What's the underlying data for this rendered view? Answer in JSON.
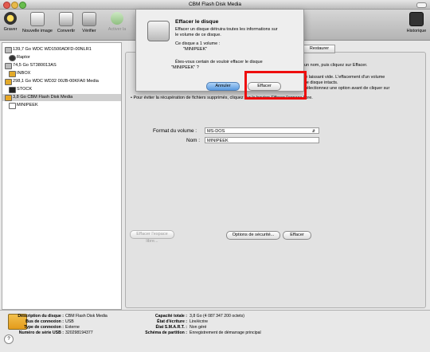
{
  "window": {
    "title": "CBM Flash Disk Media"
  },
  "toolbar": {
    "items": [
      {
        "label": "Graver",
        "icon": "burn-icon"
      },
      {
        "label": "Nouvelle image",
        "icon": "new-image-icon"
      },
      {
        "label": "Convertir",
        "icon": "convert-icon"
      },
      {
        "label": "Vérifier",
        "icon": "verify-icon"
      },
      {
        "label": "Activer la",
        "icon": "enable-icon"
      }
    ],
    "right_label": "Historique"
  },
  "sidebar": {
    "items": [
      {
        "label": "139,7 Go WDC WD1500ADFD-00NLR1",
        "indent": 0
      },
      {
        "label": "Raptor",
        "indent": 1
      },
      {
        "label": "74,5 Go ST380013AS",
        "indent": 0
      },
      {
        "label": "INBOX",
        "indent": 1
      },
      {
        "label": "298,1 Go WDC WD32 00JB-00KFA0 Media",
        "indent": 0
      },
      {
        "label": "STOCK",
        "indent": 1
      },
      {
        "label": "3,8 Go CBM Flash Disk Media",
        "indent": 0,
        "selected": true
      },
      {
        "label": "MINIPEEK",
        "indent": 1
      }
    ]
  },
  "main": {
    "restore_tab": "Restaurer",
    "body_line_1": "un nom, puis cliquez sur Effacer.",
    "body_line_2": "le laissant vide. L'effacement d'un volume",
    "body_line_3": "ce disque intacts.",
    "body_line_4": "sélectionnez une option avant de cliquer sur",
    "body_line_5": "• Pour éviter la récupération de fichiers supprimés, cliquez sur le bouton Effacer l'espace libre.",
    "format_label": "Format du volume :",
    "format_value": "MS-DOS",
    "name_label": "Nom :",
    "name_value": "MINIPEEK",
    "erase_free_space": "Effacer l'espace libre...",
    "security_options": "Options de sécurité...",
    "erase_button": "Effacer"
  },
  "sheet": {
    "title": "Effacer le disque",
    "subtitle_1": "Effacer un disque détruira toutes les informations sur",
    "subtitle_2": "le volume de ce disque.",
    "volume_info_1": "Ce disque a 1 volume :",
    "volume_info_2": "\"MINIPEEK\"",
    "confirm_1": "Êtes-vous certain de vouloir effacer le disque",
    "confirm_2": "\"MINIPEEK\" ?",
    "cancel": "Annuler",
    "erase": "Effacer"
  },
  "details": {
    "left": [
      {
        "key": "Description du disque :",
        "value": "CBM Flash Disk Media"
      },
      {
        "key": "Bus de connexion :",
        "value": "USB"
      },
      {
        "key": "Type de connexion :",
        "value": "Externe"
      },
      {
        "key": "Numéro de série USB :",
        "value": "320298194377"
      }
    ],
    "right": [
      {
        "key": "Capacité totale :",
        "value": "3,8 Go (4 087 347 200 octets)"
      },
      {
        "key": "État d'écriture :",
        "value": "Lire/écrire"
      },
      {
        "key": "État S.M.A.R.T. :",
        "value": "Non géré"
      },
      {
        "key": "Schéma de partition :",
        "value": "Enregistrement de démarrage principal"
      }
    ],
    "help": "?"
  },
  "colors": {
    "highlight": "#ee0d0d",
    "selection": "#cfcfcf",
    "default_button": "#5a9ae0"
  }
}
